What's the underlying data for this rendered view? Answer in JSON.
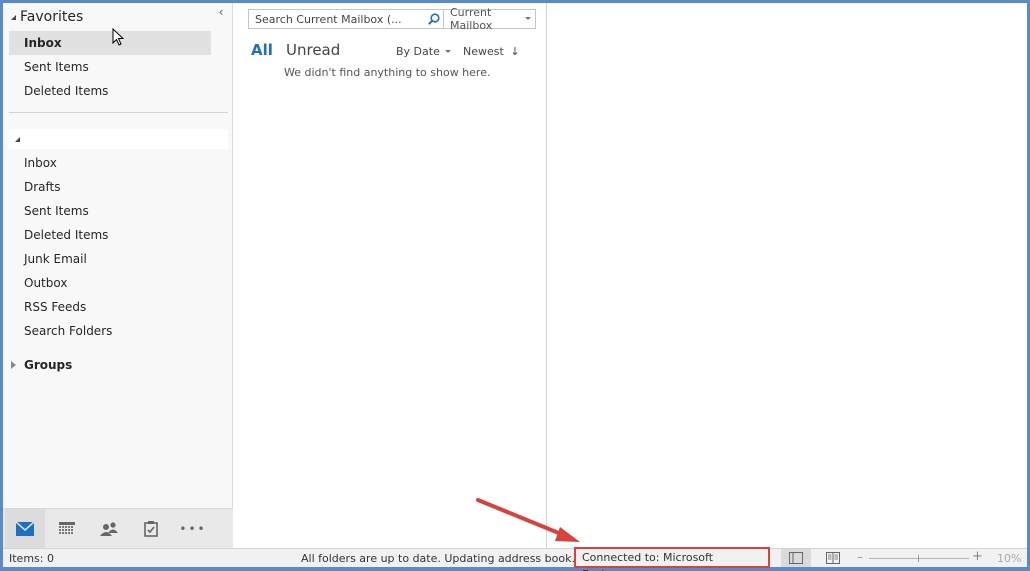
{
  "folder_pane": {
    "favorites_label": "Favorites",
    "favorites": [
      {
        "label": "Inbox",
        "selected": true
      },
      {
        "label": "Sent Items"
      },
      {
        "label": "Deleted Items"
      }
    ],
    "account_label": "",
    "folders": [
      {
        "label": "Inbox"
      },
      {
        "label": "Drafts"
      },
      {
        "label": "Sent Items"
      },
      {
        "label": "Deleted Items"
      },
      {
        "label": "Junk Email"
      },
      {
        "label": "Outbox"
      },
      {
        "label": "RSS Feeds"
      },
      {
        "label": "Search Folders"
      }
    ],
    "groups_label": "Groups",
    "collapse_icon": "chevron-left-icon"
  },
  "nav_bar": {
    "items": [
      {
        "name": "mail",
        "icon": "mail-icon",
        "active": true
      },
      {
        "name": "calendar",
        "icon": "calendar-icon"
      },
      {
        "name": "people",
        "icon": "people-icon"
      },
      {
        "name": "tasks",
        "icon": "tasks-icon"
      },
      {
        "name": "more",
        "icon": "more-icon",
        "glyph": "•••"
      }
    ]
  },
  "message_list": {
    "search_placeholder": "Search Current Mailbox (...",
    "scope": "Current Mailbox",
    "filter_all": "All",
    "filter_unread": "Unread",
    "sort_by": "By Date",
    "sort_order": "Newest",
    "sort_arrow": "↓",
    "empty_text": "We didn't find anything to show here."
  },
  "status_bar": {
    "items": "Items: 0",
    "sync": "All folders are up to date.  Updating address book.",
    "connection": "Connected to: Microsoft Exchange",
    "zoom_minus": "–",
    "zoom_plus": "+",
    "zoom_level": "10%"
  },
  "colors": {
    "accent": "#1e6fc4",
    "annotation": "#d9413b",
    "frame": "#5b8ac9"
  }
}
